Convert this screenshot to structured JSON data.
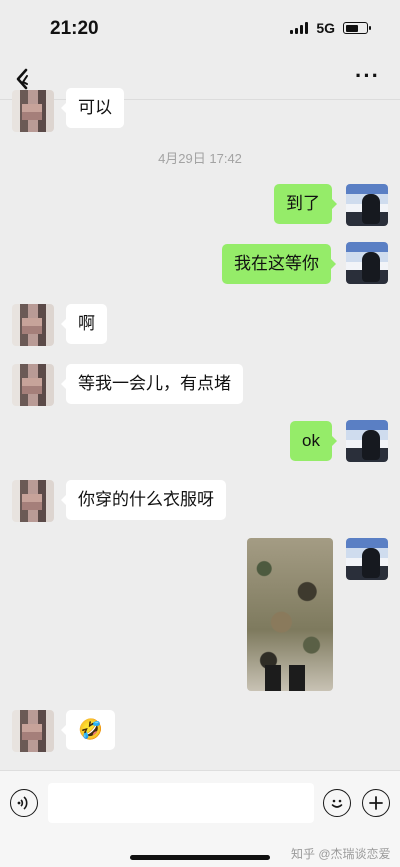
{
  "status_bar": {
    "time": "21:20",
    "network": "5G",
    "battery_level": 0.6
  },
  "nav": {
    "back_icon": "back-arrow-icon",
    "more_label": "···"
  },
  "messages": [
    {
      "side": "in",
      "text": "可以"
    },
    {
      "timestamp": "4月29日 17:42"
    },
    {
      "side": "out",
      "text": "到了"
    },
    {
      "side": "out",
      "text": "我在这等你"
    },
    {
      "side": "in",
      "text": "啊"
    },
    {
      "side": "in",
      "text": "等我一会儿，有点堵"
    },
    {
      "side": "out",
      "text": "ok"
    },
    {
      "side": "in",
      "text": "你穿的什么衣服呀"
    },
    {
      "side": "out",
      "type": "image",
      "icon": "photo-camouflage-jacket"
    },
    {
      "side": "in",
      "text": "🤣"
    }
  ],
  "input_bar": {
    "voice_icon": "voice-icon",
    "emoji_icon": "emoji-icon",
    "plus_icon": "plus-icon",
    "watermark": "知乎 @杰瑞谈恋爱"
  },
  "colors": {
    "background": "#ededed",
    "outgoing_bubble": "#95ec69",
    "incoming_bubble": "#ffffff"
  }
}
